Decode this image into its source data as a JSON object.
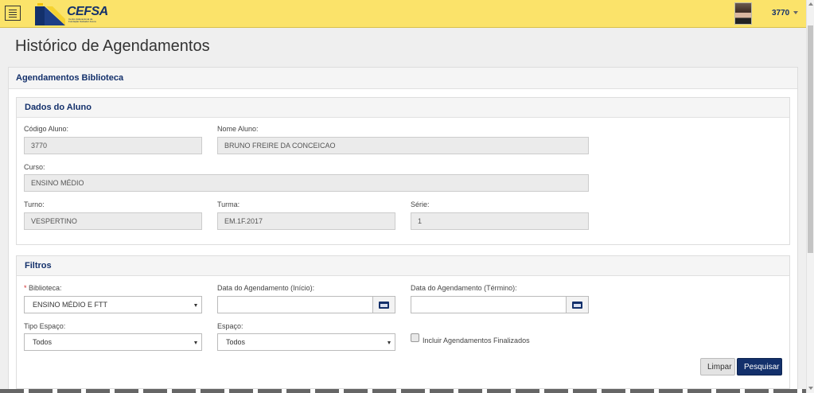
{
  "header": {
    "logo_text": "CEFSA",
    "logo_subtitle": "Centro Educacional da Fundação Salvador Arena",
    "user_code": "3770"
  },
  "page": {
    "title": "Histórico de Agendamentos",
    "section_title": "Agendamentos Biblioteca"
  },
  "student": {
    "panel_title": "Dados do Aluno",
    "code_label": "Código Aluno:",
    "code_value": "3770",
    "name_label": "Nome Aluno:",
    "name_value": "BRUNO FREIRE DA CONCEICAO",
    "course_label": "Curso:",
    "course_value": "ENSINO MÉDIO",
    "shift_label": "Turno:",
    "shift_value": "VESPERTINO",
    "class_label": "Turma:",
    "class_value": "EM.1F.2017",
    "grade_label": "Série:",
    "grade_value": "1"
  },
  "filters": {
    "panel_title": "Filtros",
    "required_mark": "*",
    "library_label": "Biblioteca:",
    "library_value": "ENSINO MÉDIO E FTT",
    "start_date_label": "Data do Agendamento (Início):",
    "start_date_value": "",
    "end_date_label": "Data do Agendamento (Término):",
    "end_date_value": "",
    "space_type_label": "Tipo Espaço:",
    "space_type_value": "Todos",
    "space_label": "Espaço:",
    "space_value": "Todos",
    "include_finished_label": "Incluir Agendamentos Finalizados",
    "include_finished_checked": false,
    "clear_button": "Limpar",
    "search_button": "Pesquisar"
  },
  "colors": {
    "header_bg": "#fbe36a",
    "brand_navy": "#13306b"
  }
}
